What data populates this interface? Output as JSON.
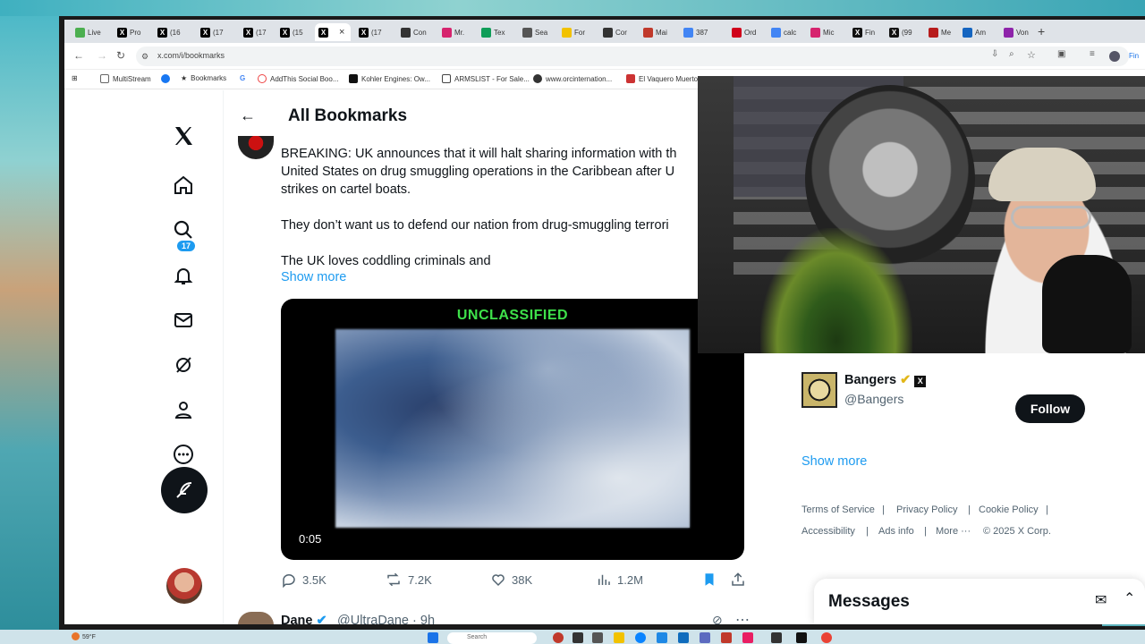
{
  "browser": {
    "tabs": [
      {
        "label": "Live",
        "fav_color": "#4caf50"
      },
      {
        "label": "Pro",
        "fav_color": "#000000"
      },
      {
        "label": "(16",
        "fav_color": "#000000"
      },
      {
        "label": "(17",
        "fav_color": "#000000"
      },
      {
        "label": "(17",
        "fav_color": "#000000"
      },
      {
        "label": "(15",
        "fav_color": "#000000"
      },
      {
        "label": "",
        "fav_color": "#000000"
      },
      {
        "label": "(17",
        "fav_color": "#000000"
      },
      {
        "label": "Con",
        "fav_color": "#333333"
      },
      {
        "label": "Mr.",
        "fav_color": "#d6246e"
      },
      {
        "label": "Tex",
        "fav_color": "#0f9d58"
      },
      {
        "label": "Sea",
        "fav_color": "#555555"
      },
      {
        "label": "For",
        "fav_color": "#f2c200"
      },
      {
        "label": "Cor",
        "fav_color": "#333333"
      },
      {
        "label": "Mai",
        "fav_color": "#c0392b"
      },
      {
        "label": "387",
        "fav_color": "#4285f4"
      },
      {
        "label": "Ord",
        "fav_color": "#d0021b"
      },
      {
        "label": "calc",
        "fav_color": "#4285f4"
      },
      {
        "label": "Mic",
        "fav_color": "#d6246e"
      },
      {
        "label": "Fin",
        "fav_color": "#111111"
      },
      {
        "label": "(99",
        "fav_color": "#111111"
      },
      {
        "label": "Me",
        "fav_color": "#b71c1c"
      },
      {
        "label": "Am",
        "fav_color": "#1565c0"
      },
      {
        "label": "Von",
        "fav_color": "#8e24aa"
      }
    ],
    "active_tab_close": "×",
    "new_tab": "+",
    "url": "x.com/i/bookmarks",
    "bookmarks": [
      "MultiStream",
      "Bookmarks",
      "AddThis Social Boo...",
      "Kohler Engines: Ow...",
      "ARMSLIST - For Sale...",
      "www.orcinternation...",
      "El Vaquero Muerto"
    ],
    "profile_label": "Fin"
  },
  "nav": {
    "notification_count": "17"
  },
  "header": {
    "title": "All Bookmarks"
  },
  "post": {
    "lines": [
      "BREAKING: UK announces that it will halt sharing information with th",
      "United States on drug smuggling operations in the Caribbean after U",
      "strikes on cartel boats.",
      "They don’t want us to defend our nation from drug-smuggling terrori",
      "The UK loves coddling criminals and"
    ],
    "show_more": "Show more",
    "video": {
      "banner": "UNCLASSIFIED",
      "duration": "0:05"
    },
    "actions": {
      "replies": "3.5K",
      "reposts": "7.2K",
      "likes": "38K",
      "views": "1.2M"
    }
  },
  "next_post": {
    "name": "Dane",
    "handle": "@UltraDane · 9h"
  },
  "who_to_follow": {
    "name": "Bangers",
    "handle": "@Bangers",
    "follow_label": "Follow",
    "show_more": "Show more"
  },
  "footer": {
    "links": [
      "Terms of Service",
      "Privacy Policy",
      "Cookie Policy",
      "Accessibility",
      "Ads info",
      "More ···",
      "© 2025 X Corp."
    ]
  },
  "messages": {
    "title": "Messages"
  },
  "taskbar": {
    "weather": "59°F",
    "search_placeholder": "Search"
  }
}
